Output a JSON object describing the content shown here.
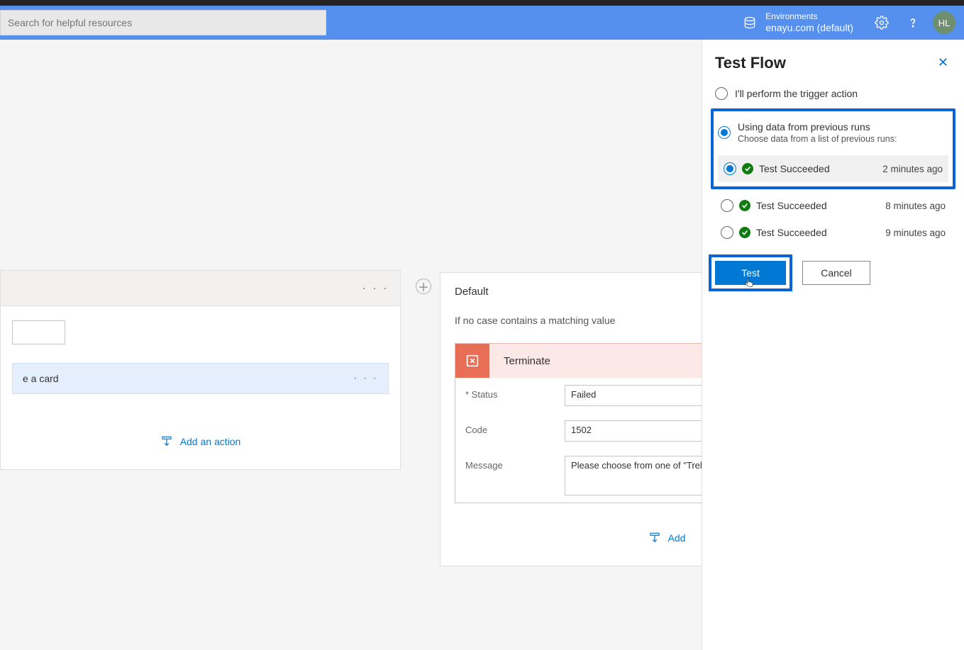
{
  "header": {
    "search_placeholder": "Search for helpful resources",
    "env_label": "Environments",
    "env_name": "enayu.com (default)",
    "avatar_initials": "HL"
  },
  "case_card": {
    "trello_text": "e a card",
    "add_action_label": "Add an action"
  },
  "default_card": {
    "title": "Default",
    "subtitle": "If no case contains a matching value",
    "terminate_label": "Terminate",
    "status_label": "* Status",
    "status_value": "Failed",
    "code_label": "Code",
    "code_value": "1502",
    "message_label": "Message",
    "message_value": "Please choose from one of \"Trello\", Tweet\"",
    "add_action_label": "Add"
  },
  "panel": {
    "title": "Test Flow",
    "option_manual": "I'll perform the trigger action",
    "option_previous": "Using data from previous runs",
    "previous_hint": "Choose data from a list of previous runs:",
    "runs": [
      {
        "status": "Test Succeeded",
        "time": "2 minutes ago",
        "selected": true
      },
      {
        "status": "Test Succeeded",
        "time": "8 minutes ago",
        "selected": false
      },
      {
        "status": "Test Succeeded",
        "time": "9 minutes ago",
        "selected": false
      }
    ],
    "test_button": "Test",
    "cancel_button": "Cancel"
  }
}
